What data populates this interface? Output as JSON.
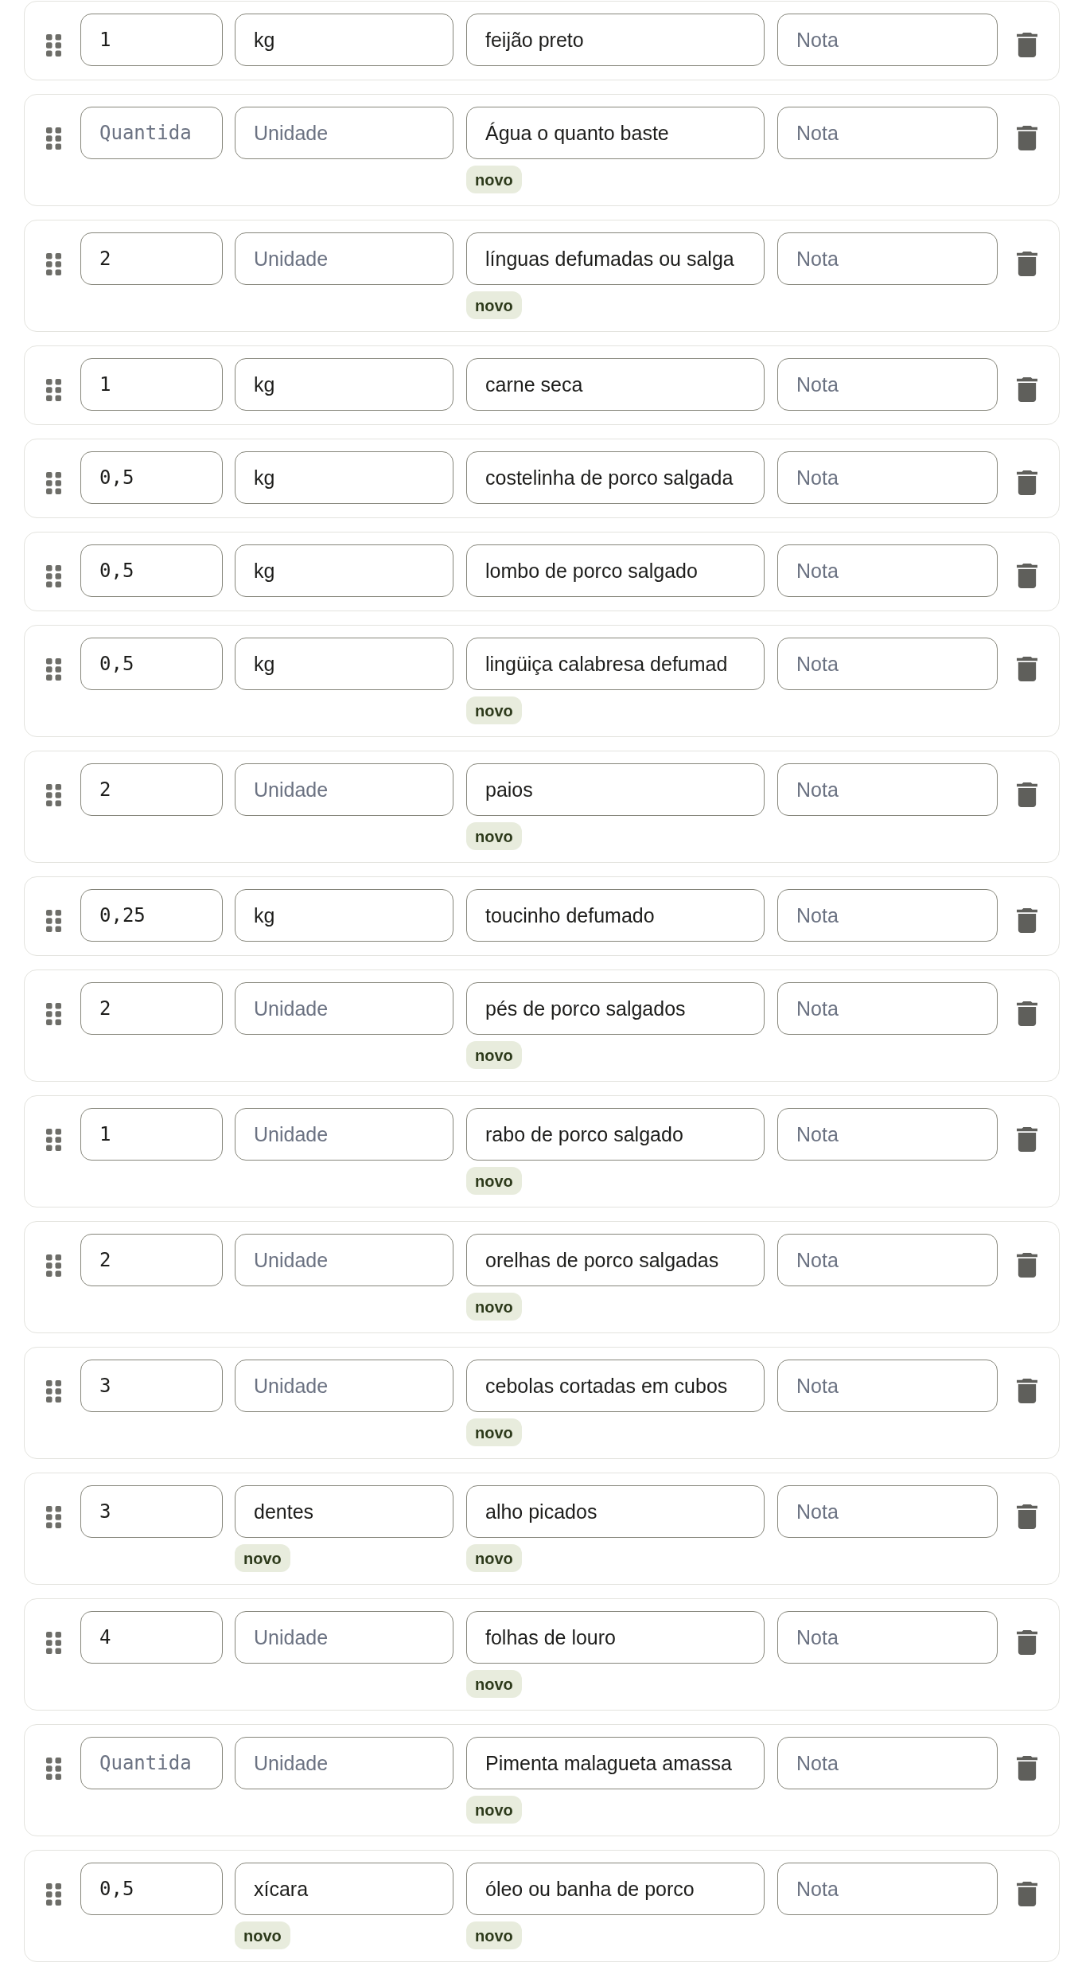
{
  "ingredients": [
    {
      "quantity": {
        "value": "1"
      },
      "unit": {
        "value": "kg"
      },
      "name": {
        "value": "feijão preto"
      },
      "note": {
        "placeholder": "Nota"
      }
    },
    {
      "quantity": {
        "placeholder": "Quantida"
      },
      "unit": {
        "placeholder": "Unidade"
      },
      "name": {
        "value": "Água o quanto baste",
        "badge": "novo"
      },
      "note": {
        "placeholder": "Nota"
      }
    },
    {
      "quantity": {
        "value": "2"
      },
      "unit": {
        "placeholder": "Unidade"
      },
      "name": {
        "value": "línguas defumadas ou salga",
        "badge": "novo"
      },
      "note": {
        "placeholder": "Nota"
      }
    },
    {
      "quantity": {
        "value": "1"
      },
      "unit": {
        "value": "kg"
      },
      "name": {
        "value": "carne seca"
      },
      "note": {
        "placeholder": "Nota"
      }
    },
    {
      "quantity": {
        "value": "0,5"
      },
      "unit": {
        "value": "kg"
      },
      "name": {
        "value": "costelinha de porco salgada"
      },
      "note": {
        "placeholder": "Nota"
      }
    },
    {
      "quantity": {
        "value": "0,5"
      },
      "unit": {
        "value": "kg"
      },
      "name": {
        "value": "lombo de porco salgado"
      },
      "note": {
        "placeholder": "Nota"
      }
    },
    {
      "quantity": {
        "value": "0,5"
      },
      "unit": {
        "value": "kg"
      },
      "name": {
        "value": "lingüiça calabresa defumad",
        "badge": "novo"
      },
      "note": {
        "placeholder": "Nota"
      }
    },
    {
      "quantity": {
        "value": "2"
      },
      "unit": {
        "placeholder": "Unidade"
      },
      "name": {
        "value": "paios",
        "badge": "novo"
      },
      "note": {
        "placeholder": "Nota"
      }
    },
    {
      "quantity": {
        "value": "0,25"
      },
      "unit": {
        "value": "kg"
      },
      "name": {
        "value": "toucinho defumado"
      },
      "note": {
        "placeholder": "Nota"
      }
    },
    {
      "quantity": {
        "value": "2"
      },
      "unit": {
        "placeholder": "Unidade"
      },
      "name": {
        "value": "pés de porco salgados",
        "badge": "novo"
      },
      "note": {
        "placeholder": "Nota"
      }
    },
    {
      "quantity": {
        "value": "1"
      },
      "unit": {
        "placeholder": "Unidade"
      },
      "name": {
        "value": "rabo de porco salgado",
        "badge": "novo"
      },
      "note": {
        "placeholder": "Nota"
      }
    },
    {
      "quantity": {
        "value": "2"
      },
      "unit": {
        "placeholder": "Unidade"
      },
      "name": {
        "value": "orelhas de porco salgadas",
        "badge": "novo"
      },
      "note": {
        "placeholder": "Nota"
      }
    },
    {
      "quantity": {
        "value": "3"
      },
      "unit": {
        "placeholder": "Unidade"
      },
      "name": {
        "value": "cebolas cortadas em cubos",
        "badge": "novo"
      },
      "note": {
        "placeholder": "Nota"
      }
    },
    {
      "quantity": {
        "value": "3"
      },
      "unit": {
        "value": "dentes",
        "badge": "novo"
      },
      "name": {
        "value": "alho picados",
        "badge": "novo"
      },
      "note": {
        "placeholder": "Nota"
      }
    },
    {
      "quantity": {
        "value": "4"
      },
      "unit": {
        "placeholder": "Unidade"
      },
      "name": {
        "value": "folhas de louro",
        "badge": "novo"
      },
      "note": {
        "placeholder": "Nota"
      }
    },
    {
      "quantity": {
        "placeholder": "Quantida"
      },
      "unit": {
        "placeholder": "Unidade"
      },
      "name": {
        "value": "Pimenta malagueta amassa",
        "badge": "novo"
      },
      "note": {
        "placeholder": "Nota"
      }
    },
    {
      "quantity": {
        "value": "0,5"
      },
      "unit": {
        "value": "xícara",
        "badge": "novo"
      },
      "name": {
        "value": "óleo ou banha de porco",
        "badge": "novo"
      },
      "note": {
        "placeholder": "Nota"
      }
    }
  ]
}
